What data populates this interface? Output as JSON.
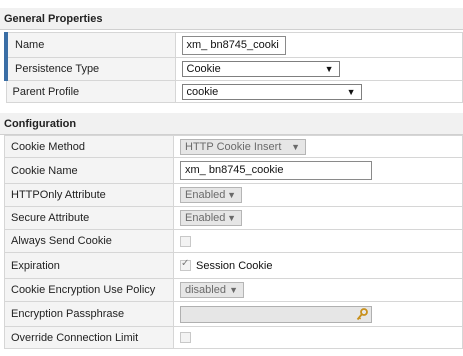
{
  "general": {
    "header": "General Properties",
    "rows": {
      "name": {
        "label": "Name",
        "value": "xm_ bn8745_cooki"
      },
      "persistence_type": {
        "label": "Persistence Type",
        "value": "Cookie"
      },
      "parent_profile": {
        "label": "Parent Profile",
        "value": "cookie"
      }
    }
  },
  "configuration": {
    "header": "Configuration",
    "rows": {
      "cookie_method": {
        "label": "Cookie Method",
        "value": "HTTP Cookie Insert"
      },
      "cookie_name": {
        "label": "Cookie Name",
        "value": "xm_ bn8745_cookie"
      },
      "httponly": {
        "label": "HTTPOnly Attribute",
        "value": "Enabled"
      },
      "secure": {
        "label": "Secure Attribute",
        "value": "Enabled"
      },
      "always_send": {
        "label": "Always Send Cookie",
        "checked": false
      },
      "expiration": {
        "label": "Expiration",
        "checked": true,
        "option_label": "Session Cookie"
      },
      "encryption_policy": {
        "label": "Cookie Encryption Use Policy",
        "value": "disabled"
      },
      "passphrase": {
        "label": "Encryption Passphrase",
        "icon": "key-icon"
      },
      "override_limit": {
        "label": "Override Connection Limit",
        "checked": false
      }
    }
  },
  "colors": {
    "row_marker": "#3a6ea5",
    "header_bg": "#f1f1f1",
    "label_bg": "#f4f4f4"
  }
}
